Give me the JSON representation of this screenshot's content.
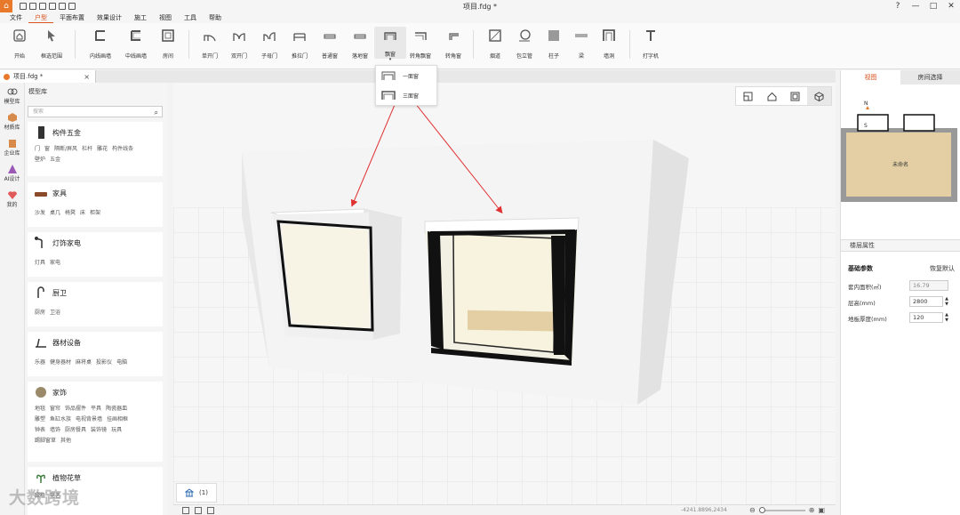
{
  "window": {
    "title": "项目.fdg *",
    "logo_glyph": "⌂",
    "controls": [
      "?",
      "—",
      "□",
      "✕"
    ]
  },
  "menu": [
    "文件",
    "户型",
    "平面布置",
    "效果设计",
    "施工",
    "视图",
    "工具",
    "帮助"
  ],
  "ribbon": [
    {
      "label": "开始",
      "icon": "home-icon"
    },
    {
      "label": "框选范围",
      "icon": "cursor-icon"
    },
    {
      "label": "内线画墙",
      "icon": "wall-inner-icon"
    },
    {
      "label": "中线画墙",
      "icon": "wall-center-icon"
    },
    {
      "label": "房间",
      "icon": "room-icon"
    },
    {
      "label": "单开门",
      "icon": "single-door-icon"
    },
    {
      "label": "双开门",
      "icon": "double-door-icon"
    },
    {
      "label": "子母门",
      "icon": "mother-child-door-icon"
    },
    {
      "label": "推拉门",
      "icon": "sliding-door-icon"
    },
    {
      "label": "普通窗",
      "icon": "window-icon"
    },
    {
      "label": "落地窗",
      "icon": "floor-window-icon"
    },
    {
      "label": "飘窗",
      "icon": "bay-window-icon"
    },
    {
      "label": "转角飘窗",
      "icon": "corner-bay-window-icon"
    },
    {
      "label": "转角窗",
      "icon": "corner-window-icon"
    },
    {
      "label": "烟道",
      "icon": "flue-icon"
    },
    {
      "label": "包立管",
      "icon": "pipe-icon"
    },
    {
      "label": "柱子",
      "icon": "column-icon"
    },
    {
      "label": "梁",
      "icon": "beam-icon"
    },
    {
      "label": "墙洞",
      "icon": "wall-hole-icon"
    },
    {
      "label": "打字机",
      "icon": "text-icon"
    }
  ],
  "dropdown": {
    "items": [
      "一面窗",
      "三面窗"
    ]
  },
  "document_tab": {
    "name": "项目.fdg *",
    "close": "×"
  },
  "left_strip": [
    "模型库",
    "材质库",
    "企业库",
    "AI设计",
    "我的"
  ],
  "library": {
    "title": "模型库",
    "search_placeholder": "搜索",
    "search_glyph": "⌕",
    "categories": [
      {
        "title": "构件五金",
        "tags": [
          "门",
          "窗",
          "隔断/屏风",
          "栏杆",
          "雕花",
          "构件线条",
          "壁炉",
          "五金"
        ]
      },
      {
        "title": "家具",
        "tags": [
          "沙发",
          "桌几",
          "椅凳",
          "床",
          "柜架"
        ]
      },
      {
        "title": "灯饰家电",
        "tags": [
          "灯具",
          "家电"
        ]
      },
      {
        "title": "厨卫",
        "tags": [
          "厨房",
          "卫浴"
        ]
      },
      {
        "title": "器材设备",
        "tags": [
          "乐器",
          "健身器材",
          "麻将桌",
          "投影仪",
          "电脑"
        ]
      },
      {
        "title": "家饰",
        "tags": [
          "地毯",
          "窗帘",
          "饰品摆件",
          "平具",
          "陶瓷器皿",
          "雕塑",
          "鱼缸水族",
          "电视背景墙",
          "挂画相框",
          "钟表",
          "墙饰",
          "厨房餐具",
          "装饰镜",
          "玩具",
          "踢脚窗草",
          "其他"
        ]
      },
      {
        "title": "植物花草",
        "tags": [
          "绿植",
          "花艺"
        ]
      }
    ]
  },
  "floor_tab": {
    "label": "(1)"
  },
  "status": {
    "coords": "-4241.8896,2434"
  },
  "right_panel": {
    "tabs": [
      "视图",
      "房间选择"
    ],
    "active_tab": 0,
    "minimap": {
      "room_label": "未命名",
      "north": "N",
      "south": "S"
    },
    "properties_title": "楼层属性",
    "basic_title": "基础参数",
    "restore_default": "恢复默认",
    "rows": [
      {
        "label": "套内面积(㎡)",
        "value": "16.79",
        "readonly": true
      },
      {
        "label": "层高(mm)",
        "value": "2800",
        "readonly": false
      },
      {
        "label": "地板厚度(mm)",
        "value": "120",
        "readonly": false
      }
    ]
  },
  "watermark": "大数跨境",
  "colors": {
    "accent": "#d9531e",
    "logo": "#e8782a",
    "arrow": "#e03030",
    "wood": "#e3cfa3"
  }
}
